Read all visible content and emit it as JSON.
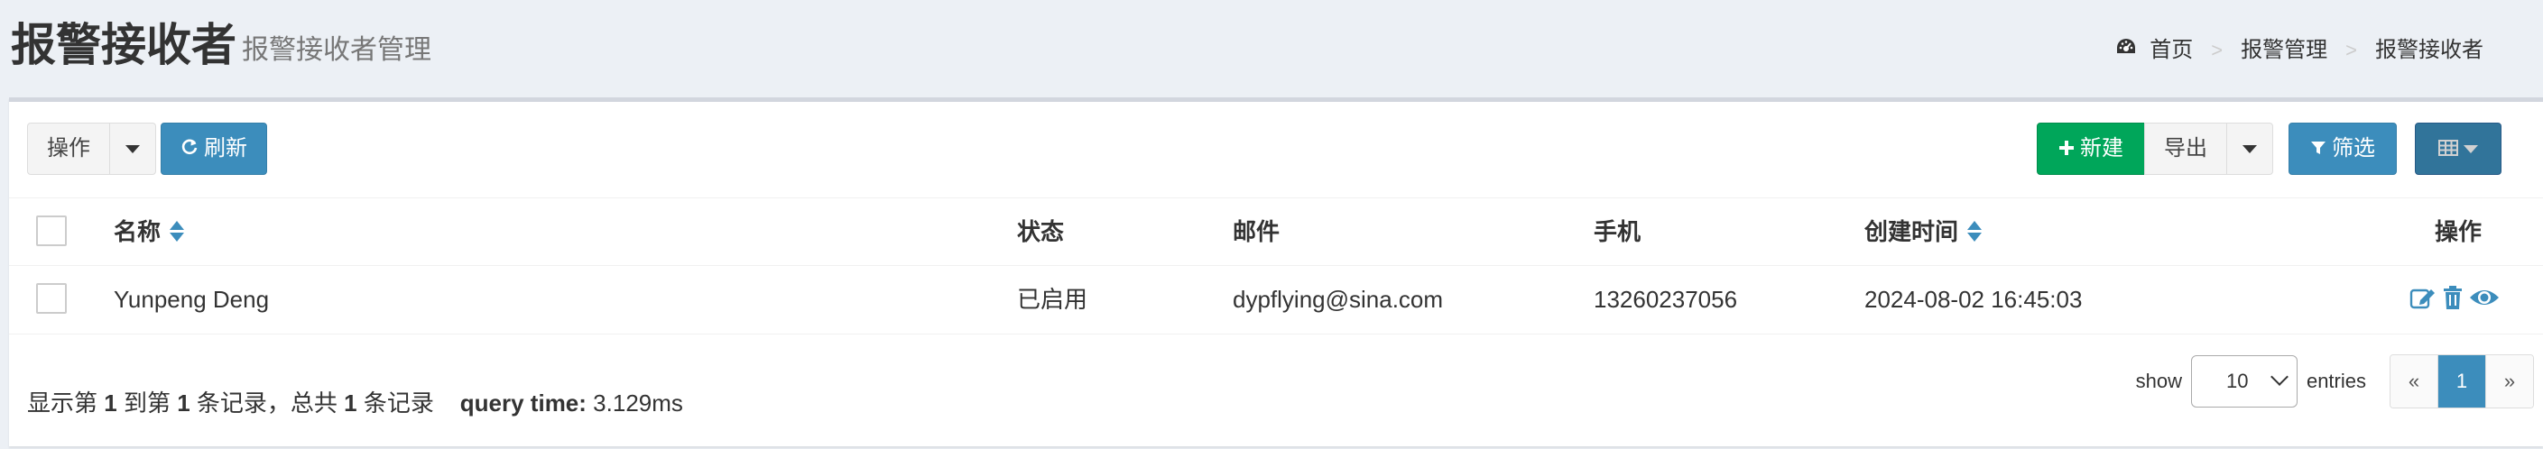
{
  "header": {
    "title": "报警接收者",
    "subtitle": "报警接收者管理"
  },
  "breadcrumb": {
    "items": [
      "首页",
      "报警管理",
      "报警接收者"
    ],
    "separator": ">"
  },
  "toolbar": {
    "ops_label": "操作",
    "refresh_label": "刷新",
    "new_label": "新建",
    "export_label": "导出",
    "filter_label": "筛选"
  },
  "table": {
    "columns": [
      "名称",
      "状态",
      "邮件",
      "手机",
      "创建时间",
      "操作"
    ],
    "rows": [
      {
        "name": "Yunpeng Deng",
        "status": "已启用",
        "email": "dypflying@sina.com",
        "phone": "13260237056",
        "created_at": "2024-08-02 16:45:03"
      }
    ],
    "row_action_icons": [
      "edit-icon",
      "trash-icon",
      "eye-icon"
    ]
  },
  "footer": {
    "summary_prefix": "显示第",
    "from": "1",
    "mid1": "到第",
    "to": "1",
    "mid2": "条记录，总共",
    "total": "1",
    "mid3": "条记录",
    "query_label": "query time:",
    "query_value": "3.129ms",
    "show_label": "show",
    "page_size": "10",
    "entries_label": "entries",
    "prev": "«",
    "current_page": "1",
    "next": "»"
  },
  "colors": {
    "primary": "#3c8dbc",
    "success": "#00a65a",
    "background": "#ecf0f5"
  }
}
